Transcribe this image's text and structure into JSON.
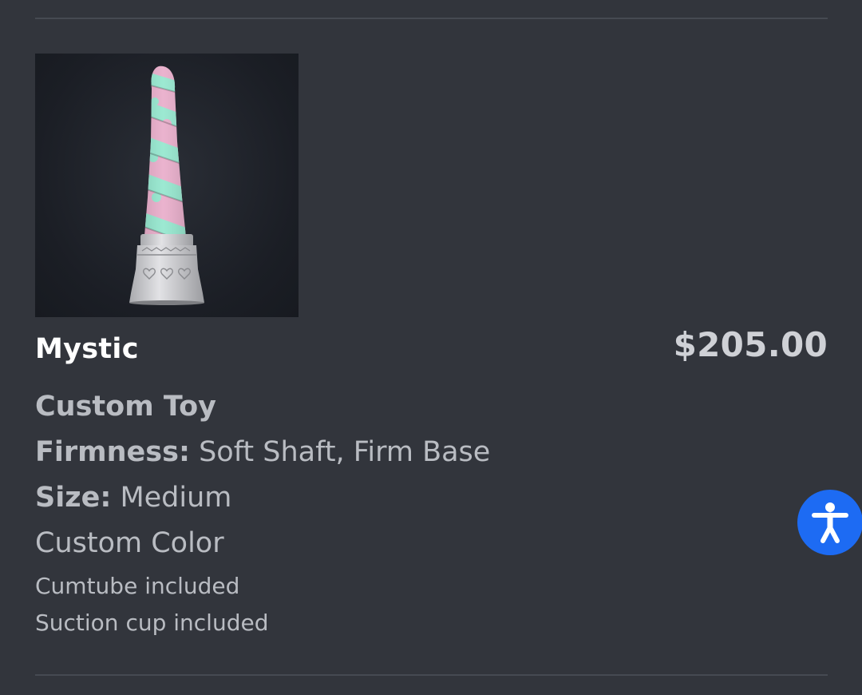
{
  "cart_item": {
    "name": "Mystic",
    "price": "$205.00",
    "image_icon": "product-thumbnail",
    "options": {
      "type": "Custom Toy",
      "firmness_label": "Firmness:",
      "firmness_value": " Soft Shaft, Firm Base",
      "size_label": "Size:",
      "size_value": " Medium",
      "color": "Custom Color",
      "extra1": "Cumtube included",
      "extra2": "Suction cup included"
    }
  },
  "accessibility": {
    "icon": "accessibility-person-icon"
  },
  "colors": {
    "background": "#32353c",
    "divider": "#464a52",
    "title": "#ffffff",
    "text": "#b9bcc2",
    "price": "#cfd1d6",
    "accessibility_button": "#1d6bf3",
    "product_mint": "#8fe6cc",
    "product_pink": "#e8a9c8",
    "product_base": "#d9d9dc"
  }
}
